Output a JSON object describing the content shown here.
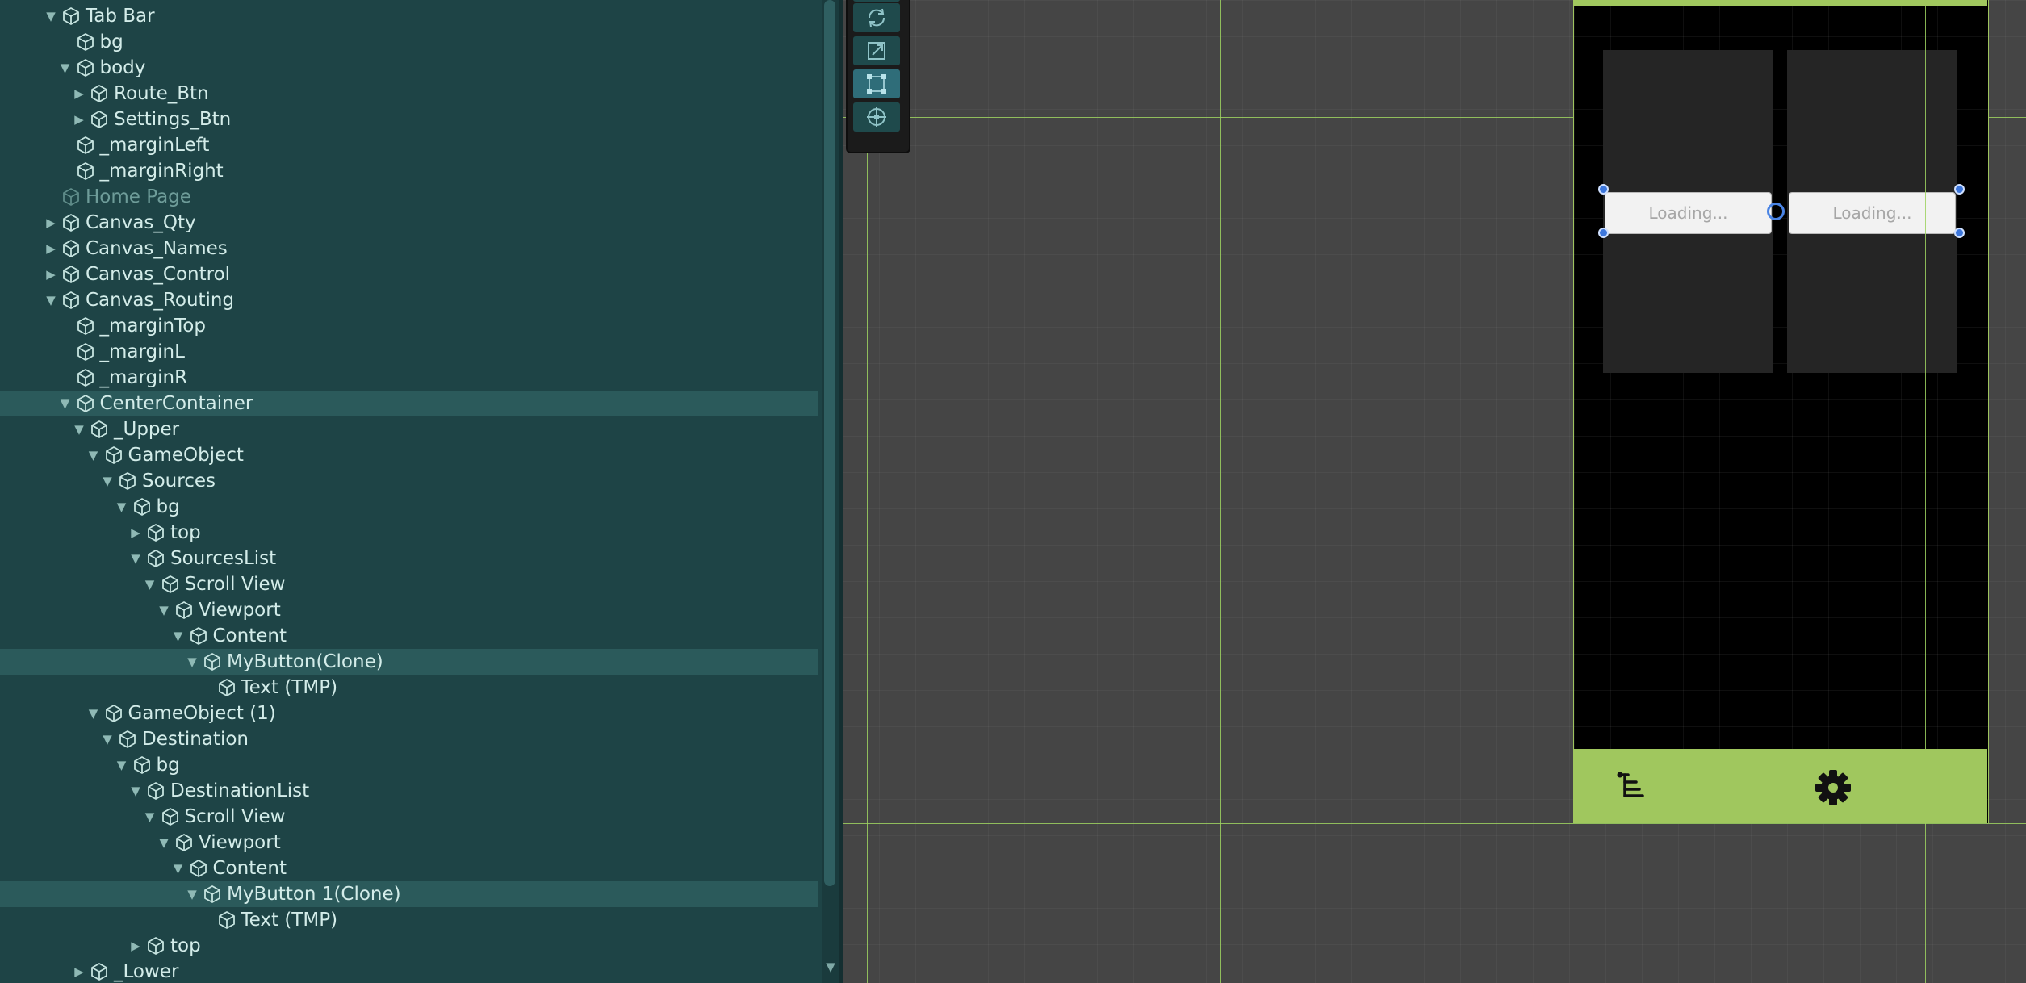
{
  "hierarchy": {
    "items": [
      {
        "label": "Tab Bar",
        "depth": 0,
        "arrow": "expanded",
        "selected": false,
        "dim": false
      },
      {
        "label": "bg",
        "depth": 1,
        "arrow": "none",
        "selected": false,
        "dim": false
      },
      {
        "label": "body",
        "depth": 1,
        "arrow": "expanded",
        "selected": false,
        "dim": false
      },
      {
        "label": "Route_Btn",
        "depth": 2,
        "arrow": "collapsed",
        "selected": false,
        "dim": false
      },
      {
        "label": "Settings_Btn",
        "depth": 2,
        "arrow": "collapsed",
        "selected": false,
        "dim": false
      },
      {
        "label": "_marginLeft",
        "depth": 1,
        "arrow": "none",
        "selected": false,
        "dim": false
      },
      {
        "label": "_marginRight",
        "depth": 1,
        "arrow": "none",
        "selected": false,
        "dim": false
      },
      {
        "label": "Home Page",
        "depth": 0,
        "arrow": "none",
        "selected": false,
        "dim": true
      },
      {
        "label": "Canvas_Qty",
        "depth": 0,
        "arrow": "collapsed",
        "selected": false,
        "dim": false
      },
      {
        "label": "Canvas_Names",
        "depth": 0,
        "arrow": "collapsed",
        "selected": false,
        "dim": false
      },
      {
        "label": "Canvas_Control",
        "depth": 0,
        "arrow": "collapsed",
        "selected": false,
        "dim": false
      },
      {
        "label": "Canvas_Routing",
        "depth": 0,
        "arrow": "expanded",
        "selected": false,
        "dim": false
      },
      {
        "label": "_marginTop",
        "depth": 1,
        "arrow": "none",
        "selected": false,
        "dim": false
      },
      {
        "label": "_marginL",
        "depth": 1,
        "arrow": "none",
        "selected": false,
        "dim": false
      },
      {
        "label": "_marginR",
        "depth": 1,
        "arrow": "none",
        "selected": false,
        "dim": false
      },
      {
        "label": "CenterContainer",
        "depth": 1,
        "arrow": "expanded",
        "selected": true,
        "dim": false
      },
      {
        "label": "_Upper",
        "depth": 2,
        "arrow": "expanded",
        "selected": false,
        "dim": false
      },
      {
        "label": "GameObject",
        "depth": 3,
        "arrow": "expanded",
        "selected": false,
        "dim": false
      },
      {
        "label": "Sources",
        "depth": 4,
        "arrow": "expanded",
        "selected": false,
        "dim": false
      },
      {
        "label": "bg",
        "depth": 5,
        "arrow": "expanded",
        "selected": false,
        "dim": false
      },
      {
        "label": "top",
        "depth": 6,
        "arrow": "collapsed",
        "selected": false,
        "dim": false
      },
      {
        "label": "SourcesList",
        "depth": 6,
        "arrow": "expanded",
        "selected": false,
        "dim": false
      },
      {
        "label": "Scroll View",
        "depth": 7,
        "arrow": "expanded",
        "selected": false,
        "dim": false
      },
      {
        "label": "Viewport",
        "depth": 8,
        "arrow": "expanded",
        "selected": false,
        "dim": false
      },
      {
        "label": "Content",
        "depth": 9,
        "arrow": "expanded",
        "selected": false,
        "dim": false
      },
      {
        "label": "MyButton(Clone)",
        "depth": 10,
        "arrow": "expanded",
        "selected": true,
        "dim": false
      },
      {
        "label": "Text (TMP)",
        "depth": 11,
        "arrow": "none",
        "selected": false,
        "dim": false
      },
      {
        "label": "GameObject (1)",
        "depth": 3,
        "arrow": "expanded",
        "selected": false,
        "dim": false
      },
      {
        "label": "Destination",
        "depth": 4,
        "arrow": "expanded",
        "selected": false,
        "dim": false
      },
      {
        "label": "bg",
        "depth": 5,
        "arrow": "expanded",
        "selected": false,
        "dim": false
      },
      {
        "label": "DestinationList",
        "depth": 6,
        "arrow": "expanded",
        "selected": false,
        "dim": false
      },
      {
        "label": "Scroll View",
        "depth": 7,
        "arrow": "expanded",
        "selected": false,
        "dim": false
      },
      {
        "label": "Viewport",
        "depth": 8,
        "arrow": "expanded",
        "selected": false,
        "dim": false
      },
      {
        "label": "Content",
        "depth": 9,
        "arrow": "expanded",
        "selected": false,
        "dim": false
      },
      {
        "label": "MyButton 1(Clone)",
        "depth": 10,
        "arrow": "expanded",
        "selected": true,
        "dim": false
      },
      {
        "label": "Text (TMP)",
        "depth": 11,
        "arrow": "none",
        "selected": false,
        "dim": false
      },
      {
        "label": "top",
        "depth": 6,
        "arrow": "collapsed",
        "selected": false,
        "dim": false
      },
      {
        "label": "_Lower",
        "depth": 2,
        "arrow": "collapsed",
        "selected": false,
        "dim": false
      }
    ]
  },
  "scene": {
    "buttons": {
      "left_label": "Loading...",
      "right_label": "Loading..."
    },
    "tabbar": {
      "route_icon": "route-tree-icon",
      "settings_icon": "gear-icon"
    }
  },
  "toolbar": {
    "tools": [
      {
        "icon": "rotate-tool-icon",
        "active": false
      },
      {
        "icon": "scale-tool-icon",
        "active": false
      },
      {
        "icon": "rect-tool-icon",
        "active": true
      },
      {
        "icon": "transform-tool-icon",
        "active": false
      }
    ]
  },
  "colors": {
    "hierarchy_bg": "#1e4446",
    "selected_row": "#2b5a5b",
    "scene_bg": "#454545",
    "accent_green": "#a0c75e",
    "handle_blue": "#3d77dc"
  }
}
